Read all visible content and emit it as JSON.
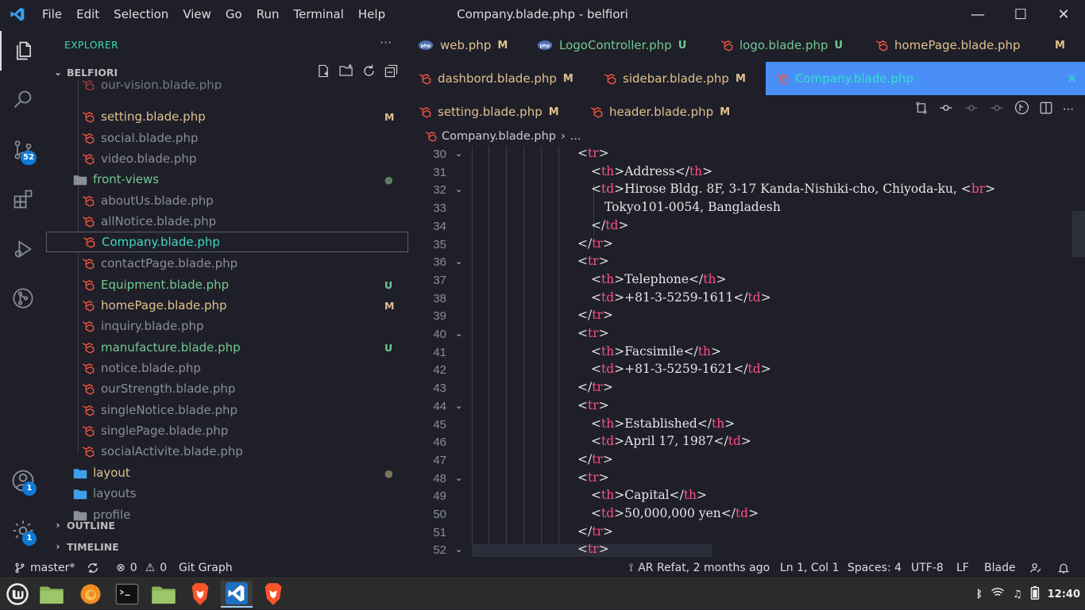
{
  "window": {
    "title": "Company.blade.php - belfiori",
    "min": "—",
    "max": "☐",
    "close": "✕"
  },
  "menu": [
    "File",
    "Edit",
    "Selection",
    "View",
    "Go",
    "Run",
    "Terminal",
    "Help"
  ],
  "activity": {
    "scm_badge": "52",
    "accounts_badge": "1",
    "settings_badge": "1"
  },
  "explorer": {
    "title": "EXPLORER",
    "dots": "···",
    "section": "BELFIORI",
    "rows": [
      {
        "label": "our-vision.blade.php",
        "color": "#777a86",
        "status": "",
        "status_color": ""
      },
      {
        "label": "setting.blade.php",
        "color": "#e2c08d",
        "status": "M",
        "status_color": "#e2c08d"
      },
      {
        "label": "social.blade.php",
        "color": "#8b8e99",
        "status": "",
        "status_color": ""
      },
      {
        "label": "video.blade.php",
        "color": "#8b8e99",
        "status": "",
        "status_color": ""
      },
      {
        "label": "front-views",
        "color": "#73c991",
        "status": "●",
        "status_color": "#5a7d5f"
      },
      {
        "label": "aboutUs.blade.php",
        "color": "#8b8e99",
        "status": "",
        "status_color": ""
      },
      {
        "label": "allNotice.blade.php",
        "color": "#8b8e99",
        "status": "",
        "status_color": ""
      },
      {
        "label": "Company.blade.php",
        "color": "#3ed7c4",
        "status": "",
        "status_color": ""
      },
      {
        "label": "contactPage.blade.php",
        "color": "#8b8e99",
        "status": "",
        "status_color": ""
      },
      {
        "label": "Equipment.blade.php",
        "color": "#73c991",
        "status": "U",
        "status_color": "#73c991"
      },
      {
        "label": "homePage.blade.php",
        "color": "#e2c08d",
        "status": "M",
        "status_color": "#e2c08d"
      },
      {
        "label": "inquiry.blade.php",
        "color": "#8b8e99",
        "status": "",
        "status_color": ""
      },
      {
        "label": "manufacture.blade.php",
        "color": "#73c991",
        "status": "U",
        "status_color": "#73c991"
      },
      {
        "label": "notice.blade.php",
        "color": "#8b8e99",
        "status": "",
        "status_color": ""
      },
      {
        "label": "ourStrength.blade.php",
        "color": "#8b8e99",
        "status": "",
        "status_color": ""
      },
      {
        "label": "singleNotice.blade.php",
        "color": "#8b8e99",
        "status": "",
        "status_color": ""
      },
      {
        "label": "singlePage.blade.php",
        "color": "#8b8e99",
        "status": "",
        "status_color": ""
      },
      {
        "label": "socialActivite.blade.php",
        "color": "#8b8e99",
        "status": "",
        "status_color": ""
      },
      {
        "label": "layout",
        "color": "#e2c08d",
        "status": "●",
        "status_color": "#7d7456"
      },
      {
        "label": "layouts",
        "color": "#8b8e99",
        "status": "",
        "status_color": ""
      },
      {
        "label": "profile",
        "color": "#8b8e99",
        "status": "",
        "status_color": ""
      }
    ],
    "outline": "OUTLINE",
    "timeline": "TIMELINE"
  },
  "tabs": [
    {
      "label": "web.php",
      "status": "M",
      "color": "#e2c08d",
      "kind": "php"
    },
    {
      "label": "LogoController.php",
      "status": "U",
      "color": "#73c991",
      "kind": "php"
    },
    {
      "label": "logo.blade.php",
      "status": "U",
      "color": "#73c991",
      "kind": "blade"
    },
    {
      "label": "homePage.blade.php",
      "status": "M",
      "color": "#e2c08d",
      "kind": "blade"
    },
    {
      "label": "dashbord.blade.php",
      "status": "M",
      "color": "#e2c08d",
      "kind": "blade"
    },
    {
      "label": "sidebar.blade.php",
      "status": "M",
      "color": "#e2c08d",
      "kind": "blade"
    },
    {
      "label": "Company.blade.php",
      "status": "",
      "color": "#2fe3c9",
      "kind": "blade"
    },
    {
      "label": "setting.blade.php",
      "status": "M",
      "color": "#e2c08d",
      "kind": "blade"
    },
    {
      "label": "header.blade.php",
      "status": "M",
      "color": "#e2c08d",
      "kind": "blade"
    }
  ],
  "breadcrumb": {
    "file": "Company.blade.php",
    "sep": "›",
    "more": "..."
  },
  "code": [
    {
      "n": "30",
      "fold": true,
      "parts": [
        [
          "t",
          "<"
        ],
        [
          "g",
          "tr"
        ],
        [
          "t",
          ">"
        ]
      ]
    },
    {
      "n": "31",
      "fold": false,
      "parts": [
        [
          "t",
          "<"
        ],
        [
          "g",
          "th"
        ],
        [
          "t",
          ">Address</"
        ],
        [
          "g",
          "th"
        ],
        [
          "t",
          ">"
        ]
      ]
    },
    {
      "n": "32",
      "fold": true,
      "parts": [
        [
          "t",
          "<"
        ],
        [
          "g",
          "td"
        ],
        [
          "t",
          ">Hirose Bldg. 8F, 3-17 Kanda-Nishiki-cho, Chiyoda-ku, <"
        ],
        [
          "g",
          "br"
        ],
        [
          "t",
          ">"
        ]
      ]
    },
    {
      "n": "33",
      "fold": false,
      "parts": [
        [
          "t",
          "Tokyo101-0054, Bangladesh"
        ]
      ]
    },
    {
      "n": "34",
      "fold": false,
      "parts": [
        [
          "t",
          "</"
        ],
        [
          "g",
          "td"
        ],
        [
          "t",
          ">"
        ]
      ]
    },
    {
      "n": "35",
      "fold": false,
      "parts": [
        [
          "t",
          "</"
        ],
        [
          "g",
          "tr"
        ],
        [
          "t",
          ">"
        ]
      ]
    },
    {
      "n": "36",
      "fold": true,
      "parts": [
        [
          "t",
          "<"
        ],
        [
          "g",
          "tr"
        ],
        [
          "t",
          ">"
        ]
      ]
    },
    {
      "n": "37",
      "fold": false,
      "parts": [
        [
          "t",
          "<"
        ],
        [
          "g",
          "th"
        ],
        [
          "t",
          ">Telephone</"
        ],
        [
          "g",
          "th"
        ],
        [
          "t",
          ">"
        ]
      ]
    },
    {
      "n": "38",
      "fold": false,
      "parts": [
        [
          "t",
          "<"
        ],
        [
          "g",
          "td"
        ],
        [
          "t",
          ">+81-3-5259-1611</"
        ],
        [
          "g",
          "td"
        ],
        [
          "t",
          ">"
        ]
      ]
    },
    {
      "n": "39",
      "fold": false,
      "parts": [
        [
          "t",
          "</"
        ],
        [
          "g",
          "tr"
        ],
        [
          "t",
          ">"
        ]
      ]
    },
    {
      "n": "40",
      "fold": true,
      "parts": [
        [
          "t",
          "<"
        ],
        [
          "g",
          "tr"
        ],
        [
          "t",
          ">"
        ]
      ]
    },
    {
      "n": "41",
      "fold": false,
      "parts": [
        [
          "t",
          "<"
        ],
        [
          "g",
          "th"
        ],
        [
          "t",
          ">Facsimile</"
        ],
        [
          "g",
          "th"
        ],
        [
          "t",
          ">"
        ]
      ]
    },
    {
      "n": "42",
      "fold": false,
      "parts": [
        [
          "t",
          "<"
        ],
        [
          "g",
          "td"
        ],
        [
          "t",
          ">+81-3-5259-1621</"
        ],
        [
          "g",
          "td"
        ],
        [
          "t",
          ">"
        ]
      ]
    },
    {
      "n": "43",
      "fold": false,
      "parts": [
        [
          "t",
          "</"
        ],
        [
          "g",
          "tr"
        ],
        [
          "t",
          ">"
        ]
      ]
    },
    {
      "n": "44",
      "fold": true,
      "parts": [
        [
          "t",
          "<"
        ],
        [
          "g",
          "tr"
        ],
        [
          "t",
          ">"
        ]
      ]
    },
    {
      "n": "45",
      "fold": false,
      "parts": [
        [
          "t",
          "<"
        ],
        [
          "g",
          "th"
        ],
        [
          "t",
          ">Established</"
        ],
        [
          "g",
          "th"
        ],
        [
          "t",
          ">"
        ]
      ]
    },
    {
      "n": "46",
      "fold": false,
      "parts": [
        [
          "t",
          "<"
        ],
        [
          "g",
          "td"
        ],
        [
          "t",
          ">April 17, 1987</"
        ],
        [
          "g",
          "td"
        ],
        [
          "t",
          ">"
        ]
      ]
    },
    {
      "n": "47",
      "fold": false,
      "parts": [
        [
          "t",
          "</"
        ],
        [
          "g",
          "tr"
        ],
        [
          "t",
          ">"
        ]
      ]
    },
    {
      "n": "48",
      "fold": true,
      "parts": [
        [
          "t",
          "<"
        ],
        [
          "g",
          "tr"
        ],
        [
          "t",
          ">"
        ]
      ]
    },
    {
      "n": "49",
      "fold": false,
      "parts": [
        [
          "t",
          "<"
        ],
        [
          "g",
          "th"
        ],
        [
          "t",
          ">Capital</"
        ],
        [
          "g",
          "th"
        ],
        [
          "t",
          ">"
        ]
      ]
    },
    {
      "n": "50",
      "fold": false,
      "parts": [
        [
          "t",
          "<"
        ],
        [
          "g",
          "td"
        ],
        [
          "t",
          ">50,000,000 yen</"
        ],
        [
          "g",
          "td"
        ],
        [
          "t",
          ">"
        ]
      ]
    },
    {
      "n": "51",
      "fold": false,
      "parts": [
        [
          "t",
          "</"
        ],
        [
          "g",
          "tr"
        ],
        [
          "t",
          ">"
        ]
      ]
    },
    {
      "n": "52",
      "fold": true,
      "parts": [
        [
          "t",
          "<"
        ],
        [
          "g",
          "tr"
        ],
        [
          "t",
          ">"
        ]
      ]
    }
  ],
  "status": {
    "branch": "master*",
    "errors": "0",
    "warnings": "0",
    "gitgraph": "Git Graph",
    "blame": "AR Refat, 2 months ago",
    "position": "Ln 1, Col 1",
    "spaces": "Spaces: 4",
    "encoding": "UTF-8",
    "eol": "LF",
    "language": "Blade"
  },
  "taskbar": {
    "clock": "12:40"
  },
  "colors": {
    "accent_tab": "#4a8ff7",
    "blade_red": "#f05340",
    "tag": "#ff4f83"
  }
}
